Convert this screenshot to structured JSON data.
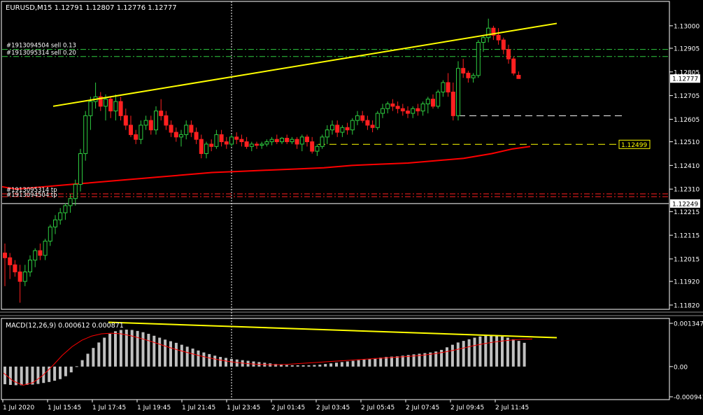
{
  "chart_title": "EURUSD,M15  1.12791 1.12807 1.12776 1.12777",
  "macd_title": "MACD(12,26,9) 0.000612 0.000871",
  "colors": {
    "background": "#000000",
    "frame": "#ffffff",
    "bull_candle": "#2ecc40",
    "bear_candle": "#ff2020",
    "trend_line": "#ffff00",
    "moving_average": "#ff0000",
    "macd_histogram": "#c0c0c0",
    "macd_signal": "#ff0000",
    "order_line": "#2ecc40",
    "level_line": "#ffff00",
    "current_line": "#ffffff"
  },
  "order_labels": [
    {
      "text": "#1913094504 sell 0.13",
      "price": 1.129
    },
    {
      "text": "#1913095314 sell 0.20",
      "price": 1.1287
    }
  ],
  "sl_labels": [
    {
      "text": "#1913095314 tp",
      "price": 1.1229
    },
    {
      "text": "#1913094504 tp",
      "price": 1.12278
    }
  ],
  "price_badges": [
    {
      "text": "1.12777",
      "price": 1.12777,
      "style": "white"
    },
    {
      "text": "1.12249",
      "price": 1.12249,
      "style": "white"
    }
  ],
  "level_badge": {
    "text": "1.12499",
    "price": 1.12499
  },
  "chart_data": {
    "type": "candlestick",
    "symbol": "EURUSD",
    "timeframe": "M15",
    "price_ticks": [
      "1.13000",
      "1.12905",
      "1.12805",
      "1.12705",
      "1.12605",
      "1.12510",
      "1.12410",
      "1.12310",
      "1.12215",
      "1.12115",
      "1.12015",
      "1.11920",
      "1.11820"
    ],
    "price_range": [
      1.11805,
      1.131
    ],
    "time_labels": [
      "1 Jul 2020",
      "1 Jul 15:45",
      "1 Jul 17:45",
      "1 Jul 19:45",
      "1 Jul 21:45",
      "1 Jul 23:45",
      "2 Jul 01:45",
      "2 Jul 03:45",
      "2 Jul 05:45",
      "2 Jul 07:45",
      "2 Jul 09:45",
      "2 Jul 11:45"
    ],
    "candles": [
      [
        1.1204,
        1.1208,
        1.119,
        1.1202
      ],
      [
        1.1202,
        1.1204,
        1.1193,
        1.1199
      ],
      [
        1.1199,
        1.1201,
        1.1194,
        1.1196
      ],
      [
        1.1196,
        1.1199,
        1.1183,
        1.1192
      ],
      [
        1.1192,
        1.1199,
        1.119,
        1.1196
      ],
      [
        1.1196,
        1.1203,
        1.1194,
        1.1201
      ],
      [
        1.1201,
        1.1206,
        1.1198,
        1.1205
      ],
      [
        1.1205,
        1.1208,
        1.1201,
        1.1203
      ],
      [
        1.1203,
        1.121,
        1.1201,
        1.1209
      ],
      [
        1.1209,
        1.1216,
        1.1207,
        1.1215
      ],
      [
        1.1215,
        1.122,
        1.1212,
        1.1218
      ],
      [
        1.1218,
        1.1223,
        1.1216,
        1.1221
      ],
      [
        1.1221,
        1.1225,
        1.1218,
        1.1224
      ],
      [
        1.1224,
        1.1229,
        1.1221,
        1.1227
      ],
      [
        1.1227,
        1.1235,
        1.1224,
        1.1233
      ],
      [
        1.1233,
        1.1248,
        1.123,
        1.1246
      ],
      [
        1.1246,
        1.1264,
        1.1243,
        1.1262
      ],
      [
        1.1262,
        1.127,
        1.1256,
        1.1268
      ],
      [
        1.1268,
        1.1276,
        1.1265,
        1.127
      ],
      [
        1.127,
        1.1272,
        1.1264,
        1.1266
      ],
      [
        1.1266,
        1.1271,
        1.126,
        1.1269
      ],
      [
        1.1269,
        1.127,
        1.1261,
        1.1264
      ],
      [
        1.1264,
        1.1271,
        1.126,
        1.1268
      ],
      [
        1.1268,
        1.127,
        1.126,
        1.1262
      ],
      [
        1.1262,
        1.1265,
        1.1256,
        1.1258
      ],
      [
        1.1258,
        1.1262,
        1.1253,
        1.1254
      ],
      [
        1.1254,
        1.1256,
        1.125,
        1.1252
      ],
      [
        1.1252,
        1.126,
        1.125,
        1.1258
      ],
      [
        1.1258,
        1.1262,
        1.1256,
        1.126
      ],
      [
        1.126,
        1.1262,
        1.1254,
        1.1256
      ],
      [
        1.1256,
        1.1266,
        1.1254,
        1.1264
      ],
      [
        1.1264,
        1.1269,
        1.126,
        1.1262
      ],
      [
        1.1262,
        1.1264,
        1.1256,
        1.1258
      ],
      [
        1.1258,
        1.126,
        1.1253,
        1.1255
      ],
      [
        1.1255,
        1.1257,
        1.1251,
        1.1253
      ],
      [
        1.1253,
        1.1256,
        1.1249,
        1.1254
      ],
      [
        1.1254,
        1.126,
        1.1252,
        1.1258
      ],
      [
        1.1258,
        1.126,
        1.1253,
        1.1255
      ],
      [
        1.1255,
        1.1257,
        1.125,
        1.1252
      ],
      [
        1.1252,
        1.1254,
        1.1244,
        1.1246
      ],
      [
        1.1246,
        1.1251,
        1.1244,
        1.125
      ],
      [
        1.125,
        1.1252,
        1.1247,
        1.1249
      ],
      [
        1.1249,
        1.1256,
        1.1248,
        1.1254
      ],
      [
        1.1254,
        1.1256,
        1.1249,
        1.1251
      ],
      [
        1.1251,
        1.1253,
        1.1248,
        1.125
      ],
      [
        1.125,
        1.1254,
        1.1249,
        1.1253
      ],
      [
        1.1253,
        1.1255,
        1.125,
        1.1252
      ],
      [
        1.1252,
        1.1254,
        1.1249,
        1.1251
      ],
      [
        1.1251,
        1.1253,
        1.1248,
        1.1249
      ],
      [
        1.1249,
        1.1251,
        1.1247,
        1.125
      ],
      [
        1.125,
        1.1251,
        1.1248,
        1.12495
      ],
      [
        1.12495,
        1.1251,
        1.1248,
        1.125
      ],
      [
        1.125,
        1.1252,
        1.1249,
        1.1251
      ],
      [
        1.1251,
        1.1253,
        1.12495,
        1.1252
      ],
      [
        1.1252,
        1.1254,
        1.125,
        1.1251
      ],
      [
        1.1251,
        1.1253,
        1.125,
        1.12525
      ],
      [
        1.12525,
        1.1254,
        1.125,
        1.1251
      ],
      [
        1.1251,
        1.1253,
        1.125,
        1.1252
      ],
      [
        1.1252,
        1.1253,
        1.1248,
        1.125
      ],
      [
        1.125,
        1.1254,
        1.1247,
        1.1253
      ],
      [
        1.1253,
        1.1254,
        1.1249,
        1.1251
      ],
      [
        1.1251,
        1.1253,
        1.1246,
        1.1247
      ],
      [
        1.1247,
        1.125,
        1.1245,
        1.1249
      ],
      [
        1.1249,
        1.1254,
        1.1248,
        1.1253
      ],
      [
        1.1253,
        1.1258,
        1.125,
        1.1256
      ],
      [
        1.1256,
        1.126,
        1.1254,
        1.1258
      ],
      [
        1.1258,
        1.126,
        1.1253,
        1.1255
      ],
      [
        1.1255,
        1.1258,
        1.1253,
        1.1257
      ],
      [
        1.1257,
        1.1259,
        1.1254,
        1.1256
      ],
      [
        1.1256,
        1.1261,
        1.1254,
        1.126
      ],
      [
        1.126,
        1.1264,
        1.1258,
        1.1262
      ],
      [
        1.1262,
        1.1264,
        1.1259,
        1.126
      ],
      [
        1.126,
        1.1262,
        1.1256,
        1.1258
      ],
      [
        1.1258,
        1.126,
        1.1255,
        1.1257
      ],
      [
        1.1257,
        1.1264,
        1.1256,
        1.1263
      ],
      [
        1.1263,
        1.1267,
        1.1261,
        1.1265
      ],
      [
        1.1265,
        1.1268,
        1.1263,
        1.1267
      ],
      [
        1.1267,
        1.1269,
        1.1264,
        1.1266
      ],
      [
        1.1266,
        1.1268,
        1.1263,
        1.1265
      ],
      [
        1.1265,
        1.1267,
        1.1262,
        1.1264
      ],
      [
        1.1264,
        1.1266,
        1.1261,
        1.1263
      ],
      [
        1.1263,
        1.1266,
        1.1261,
        1.1265
      ],
      [
        1.1265,
        1.1267,
        1.1262,
        1.1264
      ],
      [
        1.1264,
        1.1268,
        1.1262,
        1.1267
      ],
      [
        1.1267,
        1.127,
        1.1263,
        1.1269
      ],
      [
        1.1269,
        1.1271,
        1.1265,
        1.1266
      ],
      [
        1.1266,
        1.1273,
        1.1265,
        1.1272
      ],
      [
        1.1272,
        1.1277,
        1.127,
        1.1276
      ],
      [
        1.1276,
        1.128,
        1.127,
        1.1272
      ],
      [
        1.1272,
        1.1276,
        1.126,
        1.1262
      ],
      [
        1.1262,
        1.1285,
        1.126,
        1.1282
      ],
      [
        1.1282,
        1.1286,
        1.1278,
        1.128
      ],
      [
        1.128,
        1.1281,
        1.1276,
        1.1278
      ],
      [
        1.1278,
        1.128,
        1.1276,
        1.1279
      ],
      [
        1.1279,
        1.1294,
        1.1278,
        1.1293
      ],
      [
        1.1293,
        1.1296,
        1.1289,
        1.1295
      ],
      [
        1.1295,
        1.1303,
        1.1293,
        1.1299
      ],
      [
        1.1299,
        1.13,
        1.1294,
        1.1296
      ],
      [
        1.1296,
        1.1299,
        1.1292,
        1.1294
      ],
      [
        1.1294,
        1.1295,
        1.1288,
        1.129
      ],
      [
        1.129,
        1.1292,
        1.1284,
        1.1286
      ],
      [
        1.1286,
        1.1287,
        1.1279,
        1.128
      ],
      [
        1.12791,
        1.12807,
        1.12776,
        1.12777
      ]
    ],
    "moving_average": [
      [
        0,
        1.1232
      ],
      [
        20,
        1.1231
      ],
      [
        60,
        1.1232
      ],
      [
        100,
        1.1233
      ],
      [
        140,
        1.1234
      ],
      [
        180,
        1.1235
      ],
      [
        220,
        1.1236
      ],
      [
        260,
        1.1237
      ],
      [
        300,
        1.1238
      ],
      [
        340,
        1.12385
      ],
      [
        380,
        1.1239
      ],
      [
        420,
        1.12395
      ],
      [
        460,
        1.124
      ],
      [
        500,
        1.1241
      ],
      [
        540,
        1.12415
      ],
      [
        580,
        1.1242
      ],
      [
        620,
        1.1243
      ],
      [
        660,
        1.1244
      ],
      [
        700,
        1.1246
      ],
      [
        730,
        1.1248
      ],
      [
        755,
        1.1249
      ]
    ],
    "trend_line": [
      [
        1.1266,
        76
      ],
      [
        1.1301,
        796
      ]
    ],
    "macd_range": [
      -0.000941,
      0.001347
    ],
    "macd_ticks": [
      "0.001347",
      "0.00",
      "-0.000941"
    ],
    "macd_histogram": [
      -0.00055,
      -0.00057,
      -0.00058,
      -0.00058,
      -0.00057,
      -0.00056,
      -0.00054,
      -0.00051,
      -0.00048,
      -0.00044,
      -0.00039,
      -0.0003,
      -0.00018,
      1e-05,
      0.0002,
      0.0004,
      0.00058,
      0.00075,
      0.0009,
      0.00102,
      0.0011,
      0.00114,
      0.00115,
      0.00114,
      0.00111,
      0.00107,
      0.00102,
      0.00096,
      0.0009,
      0.00084,
      0.00079,
      0.00074,
      0.00068,
      0.00062,
      0.00056,
      0.0005,
      0.00044,
      0.00039,
      0.00034,
      0.0003,
      0.00027,
      0.00024,
      0.00022,
      0.0002,
      0.00018,
      0.00016,
      0.00014,
      0.00012,
      0.0001,
      8e-05,
      6e-05,
      5e-05,
      4e-05,
      4e-05,
      4e-05,
      4e-05,
      5e-05,
      6e-05,
      8e-05,
      0.0001,
      0.00012,
      0.00014,
      0.00016,
      0.00018,
      0.0002,
      0.00022,
      0.00024,
      0.00026,
      0.00028,
      0.0003,
      0.00031,
      0.00032,
      0.00034,
      0.00036,
      0.00038,
      0.0004,
      0.00042,
      0.00044,
      0.00047,
      0.00052,
      0.0006,
      0.00068,
      0.00075,
      0.0008,
      0.00085,
      0.0009,
      0.00094,
      0.00097,
      0.00098,
      0.00097,
      0.00094,
      0.0009,
      0.00085,
      0.0008,
      0.00074
    ],
    "macd_signal": [
      [
        0,
        -0.0002
      ],
      [
        10,
        -0.00045
      ],
      [
        20,
        -0.00058
      ],
      [
        30,
        -0.0005
      ],
      [
        40,
        -0.00028
      ],
      [
        50,
        2e-05
      ],
      [
        60,
        0.00035
      ],
      [
        70,
        0.00062
      ],
      [
        80,
        0.00082
      ],
      [
        90,
        0.00095
      ],
      [
        100,
        0.00102
      ],
      [
        110,
        0.00104
      ],
      [
        120,
        0.00102
      ],
      [
        130,
        0.00096
      ],
      [
        140,
        0.00088
      ],
      [
        150,
        0.00079
      ],
      [
        160,
        0.00069
      ],
      [
        170,
        0.00059
      ],
      [
        180,
        0.0005
      ],
      [
        190,
        0.00042
      ],
      [
        200,
        0.00034
      ],
      [
        210,
        0.00027
      ],
      [
        220,
        0.00021
      ],
      [
        230,
        0.00016
      ],
      [
        240,
        0.00012
      ],
      [
        250,
        9e-05
      ],
      [
        260,
        7e-05
      ],
      [
        270,
        6e-05
      ],
      [
        280,
        6e-05
      ],
      [
        290,
        7e-05
      ],
      [
        300,
        9e-05
      ],
      [
        310,
        0.00011
      ],
      [
        320,
        0.00013
      ],
      [
        330,
        0.00015
      ],
      [
        340,
        0.00017
      ],
      [
        350,
        0.00019
      ],
      [
        360,
        0.00021
      ],
      [
        370,
        0.00023
      ],
      [
        380,
        0.00025
      ],
      [
        390,
        0.00027
      ],
      [
        400,
        0.00029
      ],
      [
        410,
        0.00031
      ],
      [
        420,
        0.00033
      ],
      [
        430,
        0.00036
      ],
      [
        440,
        0.0004
      ],
      [
        450,
        0.00045
      ],
      [
        460,
        0.00051
      ],
      [
        470,
        0.00058
      ],
      [
        480,
        0.00065
      ],
      [
        490,
        0.00071
      ],
      [
        500,
        0.00076
      ],
      [
        510,
        0.0008
      ],
      [
        520,
        0.00083
      ],
      [
        530,
        0.00085
      ],
      [
        540,
        0.00086
      ]
    ],
    "macd_trend_line": [
      [
        0.00138,
        155
      ],
      [
        0.0009,
        796
      ]
    ],
    "levels": {
      "sell_orders": [
        1.129,
        1.1287
      ],
      "take_profits": [
        1.1229,
        1.12278
      ],
      "white_dashed": 1.1262,
      "yellow_dashed": 1.12499,
      "current_bid": 1.12777,
      "bottom_line": 1.12249
    }
  }
}
